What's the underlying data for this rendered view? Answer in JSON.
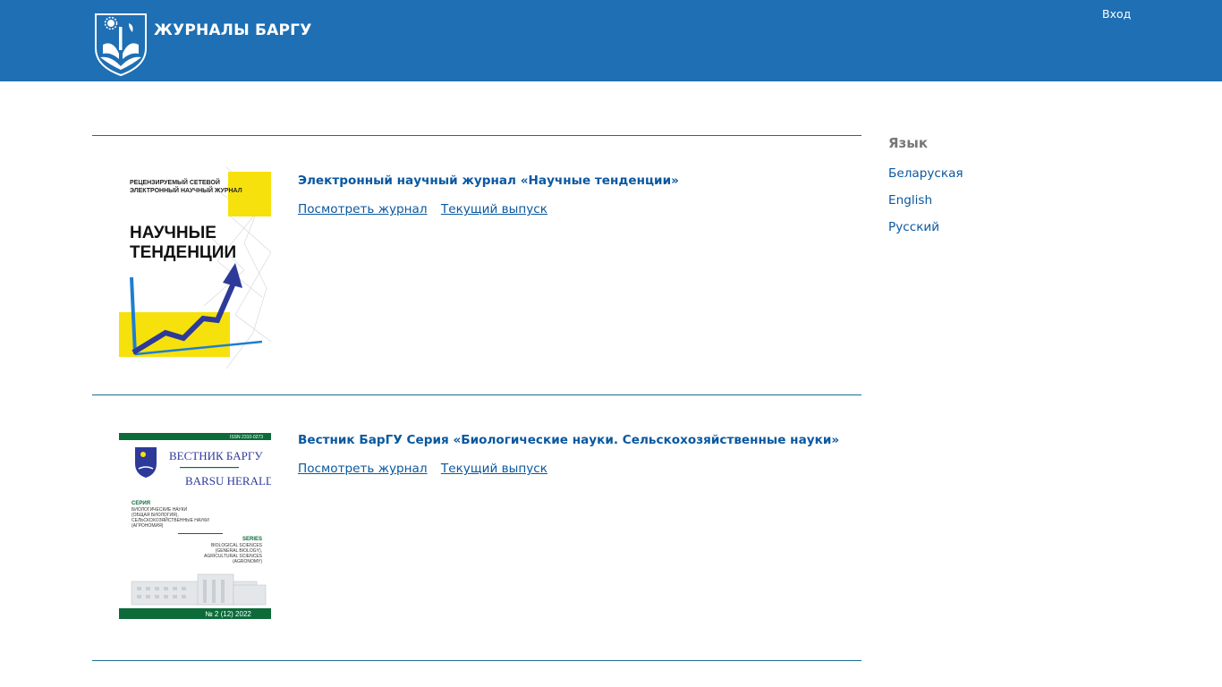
{
  "header": {
    "site_title": "ЖУРНАЛЫ БАРГУ",
    "login_label": "Вход",
    "bg_color": "#1e6fb3"
  },
  "journals": [
    {
      "title": "Электронный научный журнал «Научные тенденции»",
      "view_label": "Посмотреть журнал",
      "current_label": "Текущий выпуск",
      "cover": {
        "line1": "РЕЦЕНЗИРУЕМЫЙ СЕТЕВОЙ",
        "line2": "ЭЛЕКТРОННЫЙ НАУЧНЫЙ ЖУРНАЛ",
        "big1": "НАУЧНЫЕ",
        "big2": "ТЕНДЕНЦИИ"
      }
    },
    {
      "title": "Вестник БарГУ Серия «Биологические науки. Сельскохозяйственные науки»",
      "view_label": "Посмотреть журнал",
      "current_label": "Текущий выпуск",
      "cover": {
        "issn": "ISSN 2310-0273",
        "name_ru": "ВЕСТНИК БАРГУ",
        "name_en": "BARSU HERALD",
        "series_ru": "СЕРИЯ",
        "sub_ru_1": "БИОЛОГИЧЕСКИЕ НАУКИ",
        "sub_ru_2": "(ОБЩАЯ БИОЛОГИЯ),",
        "sub_ru_3": "СЕЛЬСКОХОЗЯЙСТВЕННЫЕ НАУКИ",
        "sub_ru_4": "(АГРОНОМИЯ)",
        "series_en": "SERIES",
        "sub_en_1": "BIOLOGICAL SCIENCES",
        "sub_en_2": "(GENERAL BIOLOGY),",
        "sub_en_3": "AGRICULTURAL SCIENCES",
        "sub_en_4": "(AGRONOMY)",
        "issue": "№ 2 (12) 2022"
      }
    }
  ],
  "sidebar": {
    "title": "Язык",
    "languages": [
      "Беларуская",
      "English",
      "Русский"
    ]
  }
}
